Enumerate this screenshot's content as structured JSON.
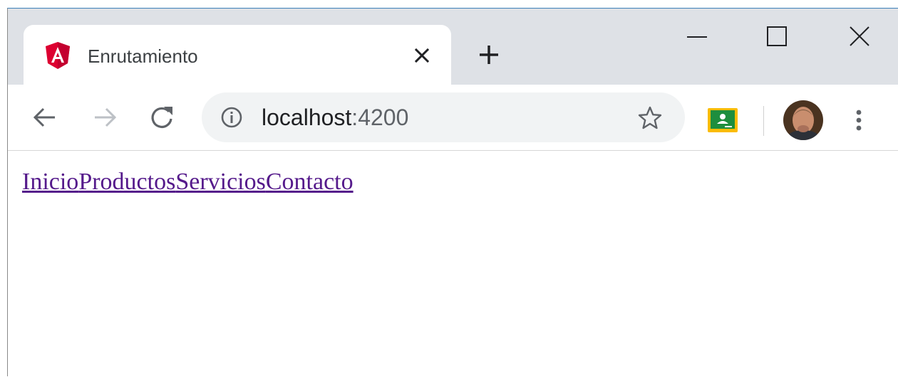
{
  "tab": {
    "title": "Enrutamiento",
    "favicon": "angular-icon",
    "favicon_color": "#dd0031"
  },
  "address_bar": {
    "host": "localhost",
    "port": ":4200"
  },
  "page": {
    "links": [
      "Inicio",
      "Productos",
      "Servicios",
      "Contacto"
    ],
    "link_color": "#551a8b"
  },
  "icons": {
    "tab_close": "close-icon",
    "new_tab": "plus-icon",
    "minimize": "minimize-icon",
    "maximize": "maximize-icon",
    "window_close": "close-icon",
    "back": "arrow-left-icon",
    "forward": "arrow-right-icon",
    "reload": "reload-icon",
    "site_info": "info-icon",
    "bookmark": "star-icon",
    "extension": "google-classroom-icon",
    "profile": "avatar",
    "menu": "kebab-menu-icon"
  }
}
